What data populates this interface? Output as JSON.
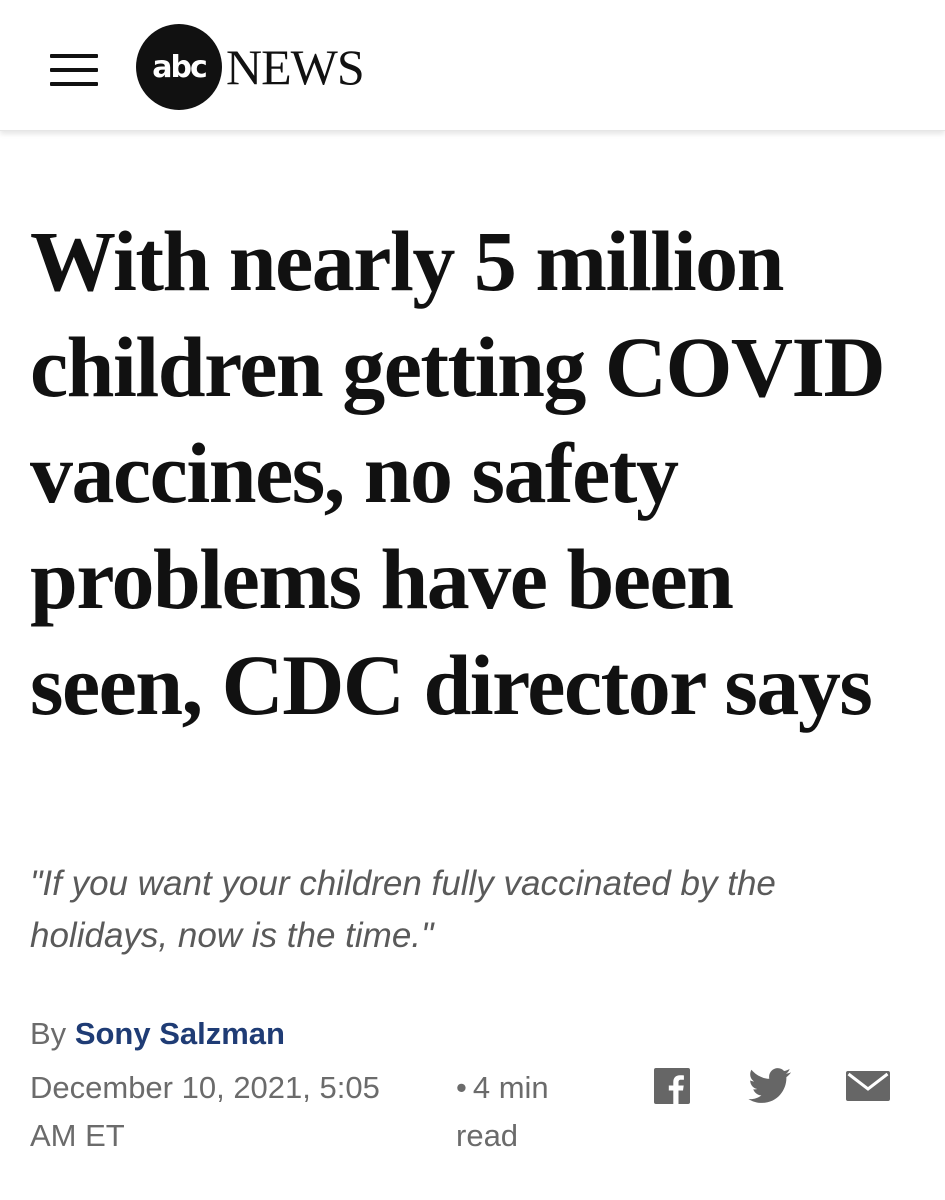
{
  "header": {
    "menu_icon": "hamburger-menu-icon",
    "logo": {
      "mark_text": "abc",
      "wordmark": "NEWS"
    }
  },
  "article": {
    "headline": "With nearly 5 million children getting COVID vaccines, no safety problems have been seen, CDC director says",
    "subheadline": "\"If you want your children fully vaccinated by the holidays, now is the time.\"",
    "byline": {
      "prefix": "By",
      "author": "Sony Salzman"
    },
    "date": "December 10, 2021, 5:05 AM ET",
    "read_time_dot": "•",
    "read_time": "4 min read"
  },
  "share": {
    "icons": [
      "facebook-icon",
      "twitter-icon",
      "email-icon"
    ]
  },
  "colors": {
    "author_link": "#1f3c75",
    "meta_text": "#6b6b6b",
    "subhead_text": "#5a5a5a",
    "headline_text": "#111111"
  }
}
